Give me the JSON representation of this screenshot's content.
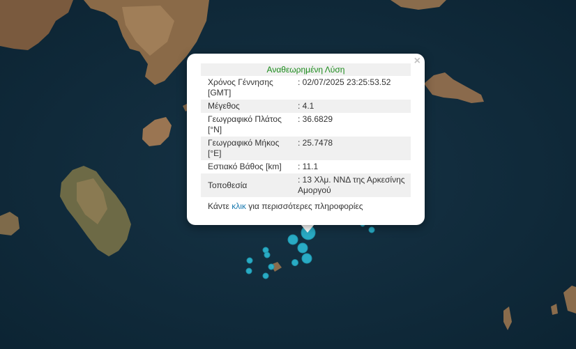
{
  "popup": {
    "title": "Αναθεωρημένη Λύση",
    "close_symbol": "×",
    "rows": [
      {
        "label": "Χρόνος Γέννησης [GMT]",
        "value": ": 02/07/2025 23:25:53.52"
      },
      {
        "label": "Μέγεθος",
        "value": ": 4.1"
      },
      {
        "label": "Γεωγραφικό Πλάτος [°N]",
        "value": ": 36.6829"
      },
      {
        "label": "Γεωγραφικό Μήκος [°E]",
        "value": ": 25.7478"
      },
      {
        "label": "Εστιακό Βάθος [km]",
        "value": ": 11.1"
      },
      {
        "label": "Τοποθεσία",
        "value": ": 13 Χλμ. ΝΝΔ της Αρκεσίνης Αμοργού"
      }
    ],
    "more_prefix": "Κάντε",
    "more_link": "κλικ",
    "more_suffix": "για περισσότερες πληροφορίες"
  },
  "colors": {
    "sea": "#0f2a3a",
    "marker": "#2bb6cf",
    "title": "#1a8a1a"
  }
}
